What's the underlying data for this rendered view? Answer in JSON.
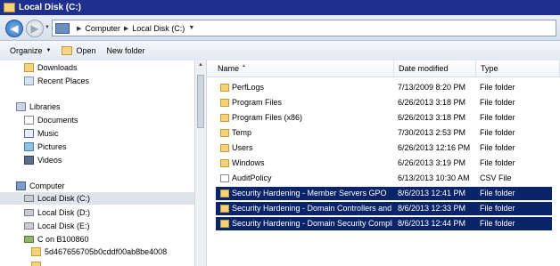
{
  "window": {
    "title": "Local Disk (C:)"
  },
  "address": {
    "crumbs": [
      "Computer",
      "Local Disk (C:)"
    ]
  },
  "toolbar": {
    "organize": "Organize",
    "open": "Open",
    "new_folder": "New folder"
  },
  "nav": {
    "items": [
      {
        "label": "Downloads",
        "icon": "folder-icon"
      },
      {
        "label": "Recent Places",
        "icon": "recent-places-icon"
      },
      {
        "label": "Libraries",
        "icon": "libraries-icon"
      },
      {
        "label": "Documents",
        "icon": "documents-icon"
      },
      {
        "label": "Music",
        "icon": "music-icon"
      },
      {
        "label": "Pictures",
        "icon": "pictures-icon"
      },
      {
        "label": "Videos",
        "icon": "videos-icon"
      },
      {
        "label": "Computer",
        "icon": "computer-icon"
      },
      {
        "label": "Local Disk (C:)",
        "icon": "disk-icon"
      },
      {
        "label": "Local Disk (D:)",
        "icon": "disk-icon"
      },
      {
        "label": "Local Disk (E:)",
        "icon": "disk-icon"
      },
      {
        "label": "C on B100860",
        "icon": "network-drive-icon"
      },
      {
        "label": "5d467656705b0cddf00ab8be4008",
        "icon": "folder-icon"
      }
    ]
  },
  "columns": {
    "name": "Name",
    "date": "Date modified",
    "type": "Type"
  },
  "files": [
    {
      "name": "PerfLogs",
      "date": "7/13/2009 8:20 PM",
      "type": "File folder",
      "icon": "folder-icon"
    },
    {
      "name": "Program Files",
      "date": "6/26/2013 3:18 PM",
      "type": "File folder",
      "icon": "folder-icon"
    },
    {
      "name": "Program Files (x86)",
      "date": "6/26/2013 3:18 PM",
      "type": "File folder",
      "icon": "folder-icon"
    },
    {
      "name": "Temp",
      "date": "7/30/2013 2:53 PM",
      "type": "File folder",
      "icon": "folder-icon"
    },
    {
      "name": "Users",
      "date": "6/26/2013 12:16 PM",
      "type": "File folder",
      "icon": "folder-icon"
    },
    {
      "name": "Windows",
      "date": "6/26/2013 3:19 PM",
      "type": "File folder",
      "icon": "folder-icon"
    },
    {
      "name": "AuditPolicy",
      "date": "6/13/2013 10:30 AM",
      "type": "CSV File",
      "icon": "csv-file-icon"
    },
    {
      "name": "Security Hardening - Member Servers GPO",
      "date": "8/6/2013 12:41 PM",
      "type": "File folder",
      "icon": "folder-icon"
    },
    {
      "name": "Security Hardening - Domain Controllers and ...",
      "date": "8/6/2013 12:33 PM",
      "type": "File folder",
      "icon": "folder-icon"
    },
    {
      "name": "Security Hardening - Domain Security Compli...",
      "date": "8/6/2013 12:44 PM",
      "type": "File folder",
      "icon": "folder-icon"
    }
  ],
  "colors": {
    "titlebar": "#1e2f8f",
    "selection": "#0a246a"
  }
}
